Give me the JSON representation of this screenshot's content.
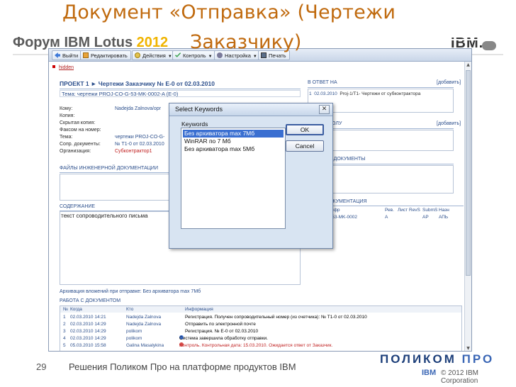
{
  "slide": {
    "title_line1": "Документ «Отправка» (Чертежи",
    "title_line2": "Заказчику)",
    "banner_text": "Форум IBM Lotus ",
    "banner_year": "2012",
    "ibm_logo": "IBM.",
    "page_number": "29",
    "footer_text": "Решения Поликом Про на платформе продуктов IBM",
    "polycom_logo_a": "ПОЛИКОМ ",
    "polycom_logo_b": "ПРО",
    "ibm_mini": "IBM",
    "copyright": "© 2012 IBM Corporation"
  },
  "toolbar": {
    "exit": "Выйти",
    "edit": "Редактировать",
    "actions": "Действия",
    "control": "Контроль",
    "settings": "Настройка",
    "print": "Печать",
    "dropdown_glyph": "▼"
  },
  "form": {
    "hidden_link": "hidden",
    "project_title": "ПРОЕКТ 1  ►  Чертежи Заказчику  № Е-0 от 02.03.2010",
    "subject": "Тема: чертежи PROJ-CO-G-53-MK-0002-A (E-0)",
    "fields": [
      {
        "label": "Кому:",
        "value": "Nadejda Zalnova/opr"
      },
      {
        "label": "Копия:",
        "value": ""
      },
      {
        "label": "Скрытая копия:",
        "value": ""
      },
      {
        "label": "Факсом на номер:",
        "value": ""
      },
      {
        "label": "Тема:",
        "value": "чертежи PROJ-CO-G-"
      },
      {
        "label": "Сопр. документы:",
        "value": "№ Т1-0 от 02.03.2010"
      },
      {
        "label": "Организация:",
        "value": "Субконтрактор1"
      }
    ],
    "files_section": "ФАЙЛЫ ИНЖЕНЕРНОЙ ДОКУМЕНТАЦИИ",
    "content_section": "СОДЕРЖАНИЕ",
    "content_text": "текст сопроводительного письма",
    "archive_line": "Архивация вложений при отправке: Без архиватора max 7Мб",
    "reply_section": "В ОТВЕТ НА",
    "add_label": "[добавить]",
    "reply_num": "1",
    "reply_date": "02.03.2010",
    "reply_text": "Proj-1/T1- Чертежи от субконтрактора",
    "section_kolu": "КОЛУ",
    "section_docs": "Е ДОКУМЕНТЫ",
    "section_documentation": "ОКУМЕНТАЦИЯ",
    "docs_headers": [
      "Шифр",
      "Рев.",
      "Лист",
      "RevS",
      "SubmS",
      "Назн"
    ],
    "docs_row": [
      "G-53-MK-0002",
      "A",
      "",
      "AP",
      "АПЬ"
    ],
    "work_section": "РАБОТА С ДОКУМЕНТОМ",
    "log_headers": {
      "num": "№",
      "when": "Когда",
      "who": "Кто",
      "info": "Информация"
    },
    "log_rows": [
      {
        "num": "1",
        "when": "02.03.2010 14:21",
        "who": "Nadejda Zalnova",
        "info": "Регистрация. Получен сопроводительный номер (из счетчика): № Т1-0 от 02.03.2010"
      },
      {
        "num": "2",
        "when": "02.03.2010 14:29",
        "who": "Nadejda Zalnova",
        "info": "Отправить по электронной почте"
      },
      {
        "num": "3",
        "when": "02.03.2010 14:29",
        "who": "polikom",
        "info": "Регистрация. № Е-0 от 02.03.2010"
      },
      {
        "num": "4",
        "when": "02.03.2010 14:29",
        "who": "polikom",
        "info": "Система завершила обработку отправки."
      },
      {
        "num": "5",
        "when": "05.03.2010 15:58",
        "who": "Galina Masalykina",
        "info": "Контроль. Контрольная дата: 15.03.2010. Ожидается ответ от Заказчик."
      }
    ]
  },
  "dialog": {
    "title": "Select Keywords",
    "close": "✕",
    "label": "Keywords",
    "items": [
      "Без архиватора max 7Мб",
      "WinRAR по 7 Мб",
      "Без архиватора max 5Мб"
    ],
    "selected_index": 0,
    "ok": "OK",
    "cancel": "Cancel"
  },
  "colors": {
    "title_orange": "#c06a0e",
    "link_blue": "#2c4f8c",
    "selection_blue": "#3a6fd1",
    "warning_red": "#c02020"
  }
}
